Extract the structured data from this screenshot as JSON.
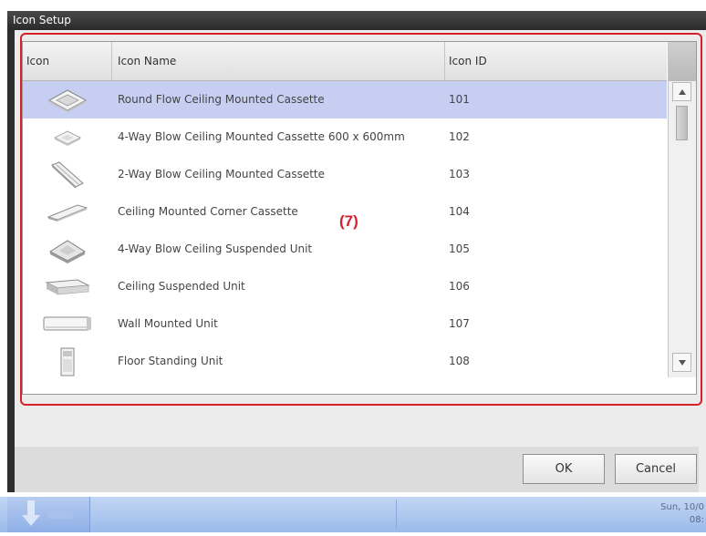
{
  "window": {
    "title": "Icon Setup"
  },
  "table": {
    "columns": [
      "Icon",
      "Icon Name",
      "Icon ID"
    ],
    "rows": [
      {
        "icon": "round-flow-cassette-icon",
        "name": "Round Flow Ceiling Mounted Cassette",
        "id": "101",
        "selected": true
      },
      {
        "icon": "four-way-cassette-600-icon",
        "name": "4-Way Blow Ceiling Mounted Cassette 600 x 600mm",
        "id": "102",
        "selected": false
      },
      {
        "icon": "two-way-cassette-icon",
        "name": "2-Way Blow Ceiling Mounted Cassette",
        "id": "103",
        "selected": false
      },
      {
        "icon": "corner-cassette-icon",
        "name": "Ceiling Mounted Corner Cassette",
        "id": "104",
        "selected": false
      },
      {
        "icon": "four-way-suspended-icon",
        "name": "4-Way Blow Ceiling Suspended Unit",
        "id": "105",
        "selected": false
      },
      {
        "icon": "ceiling-suspended-icon",
        "name": "Ceiling Suspended Unit",
        "id": "106",
        "selected": false
      },
      {
        "icon": "wall-mounted-icon",
        "name": "Wall Mounted Unit",
        "id": "107",
        "selected": false
      },
      {
        "icon": "floor-standing-icon",
        "name": "Floor Standing Unit",
        "id": "108",
        "selected": false
      }
    ]
  },
  "annotation": {
    "label": "(7)",
    "color": "#d8202c"
  },
  "buttons": {
    "ok": "OK",
    "cancel": "Cancel"
  },
  "taskbar": {
    "clock_line1": "Sun, 10/0",
    "clock_line2": "08:"
  },
  "colors": {
    "selected_row": "#c6cff2",
    "window_frame": "#2e2e2e",
    "taskbar": "#9cbbea"
  }
}
